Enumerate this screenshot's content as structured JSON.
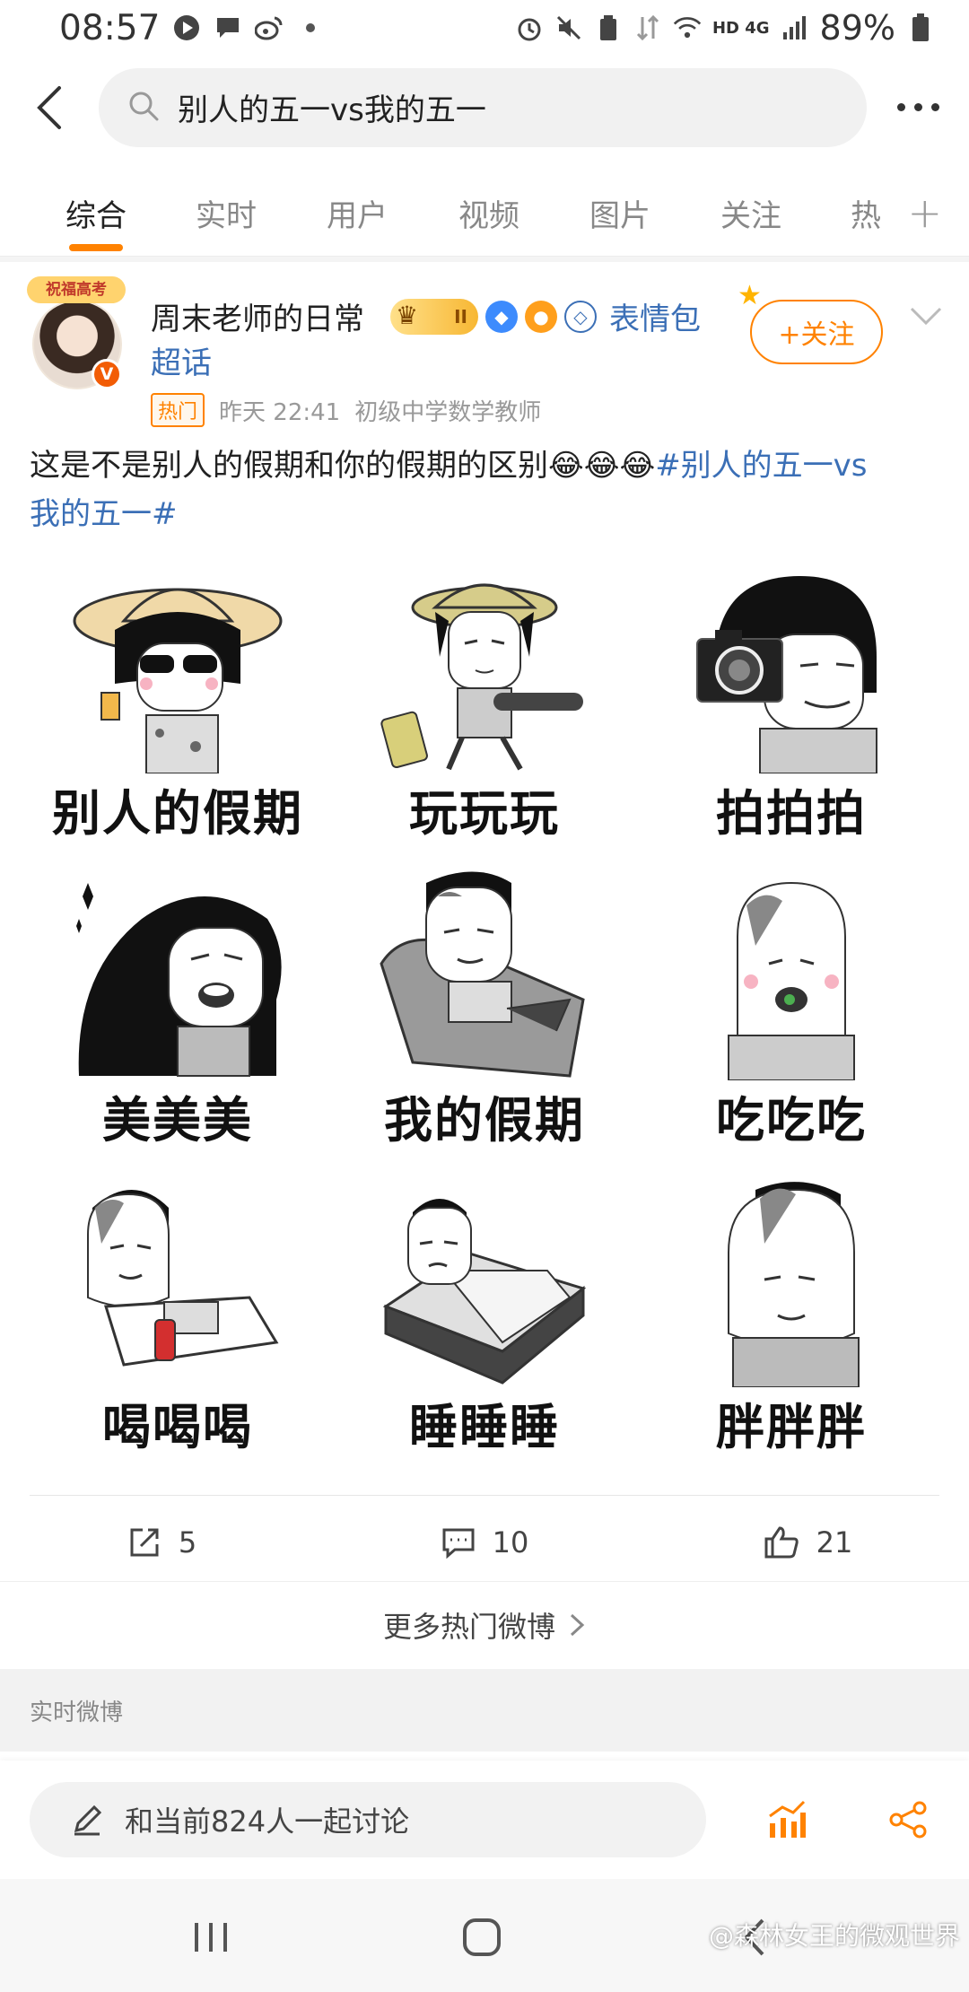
{
  "status_bar": {
    "time": "08:57",
    "network": "HD 4G",
    "battery": "89%"
  },
  "search": {
    "query": "别人的五一vs我的五一"
  },
  "tabs": [
    {
      "label": "综合",
      "active": true
    },
    {
      "label": "实时",
      "active": false
    },
    {
      "label": "用户",
      "active": false
    },
    {
      "label": "视频",
      "active": false
    },
    {
      "label": "图片",
      "active": false
    },
    {
      "label": "关注",
      "active": false
    },
    {
      "label": "热",
      "active": false
    }
  ],
  "post": {
    "avatar_banner": "祝福高考",
    "username": "周末老师的日常",
    "vip_level": "II",
    "topic_line1": "表情包",
    "topic_line2": "超话",
    "follow_label": "+关注",
    "hot_tag": "热门",
    "time": "昨天 22:41",
    "bio": "初级中学数学教师",
    "text": "这是不是别人的假期和你的假期的区别😂😂😂",
    "hashtag_part1": "#别人的五一vs",
    "hashtag_part2": "我的五一#",
    "memes": [
      {
        "caption": "别人的假期"
      },
      {
        "caption": "玩玩玩"
      },
      {
        "caption": "拍拍拍"
      },
      {
        "caption": "美美美"
      },
      {
        "caption": "我的假期"
      },
      {
        "caption": "吃吃吃"
      },
      {
        "caption": "喝喝喝"
      },
      {
        "caption": "睡睡睡"
      },
      {
        "caption": "胖胖胖"
      }
    ],
    "reposts": "5",
    "comments": "10",
    "likes": "21"
  },
  "more_hot": "更多热门微博",
  "realtime_section": "实时微博",
  "composer": {
    "placeholder": "和当前824人一起讨论"
  },
  "watermark": "@森林女王的微观世界",
  "colors": {
    "accent": "#ff8200",
    "link": "#3b6fb6"
  }
}
